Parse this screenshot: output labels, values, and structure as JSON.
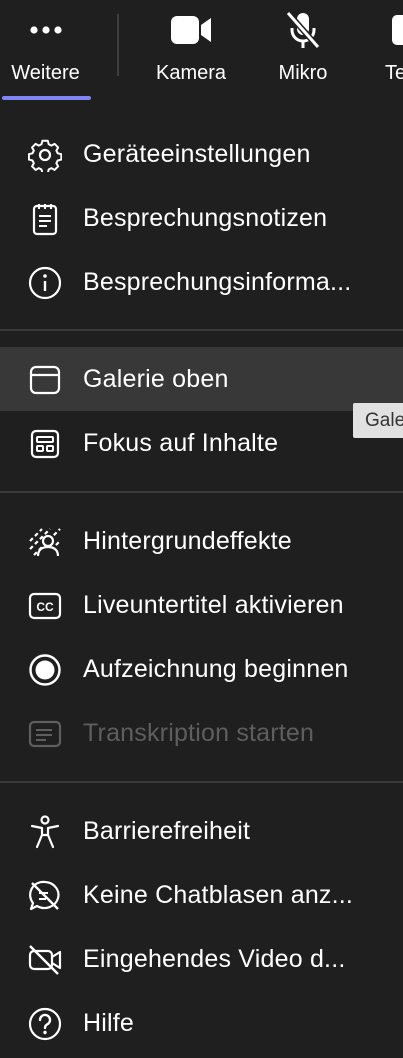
{
  "toolbar": {
    "more": {
      "label": "Weitere",
      "icon": "more-icon"
    },
    "camera": {
      "label": "Kamera",
      "icon": "camera-icon"
    },
    "mic": {
      "label": "Mikro",
      "icon": "mic-off-icon"
    },
    "partial": {
      "label": "Te"
    }
  },
  "menu": {
    "device_settings": "Geräteeinstellungen",
    "meeting_notes": "Besprechungsnotizen",
    "meeting_info": "Besprechungsinforma...",
    "gallery_top": "Galerie oben",
    "focus_content": "Fokus auf Inhalte",
    "background_effects": "Hintergrundeffekte",
    "live_captions": "Liveuntertitel aktivieren",
    "start_recording": "Aufzeichnung beginnen",
    "start_transcription": "Transkription starten",
    "accessibility": "Barrierefreiheit",
    "no_chat_bubbles": "Keine Chatblasen anz...",
    "incoming_video": "Eingehendes Video d...",
    "help": "Hilfe"
  },
  "tooltip": "Gale",
  "colors": {
    "accent": "#7f85f5",
    "background": "#1f1f1f",
    "hover": "#383838",
    "disabled": "#5e5e5e"
  }
}
